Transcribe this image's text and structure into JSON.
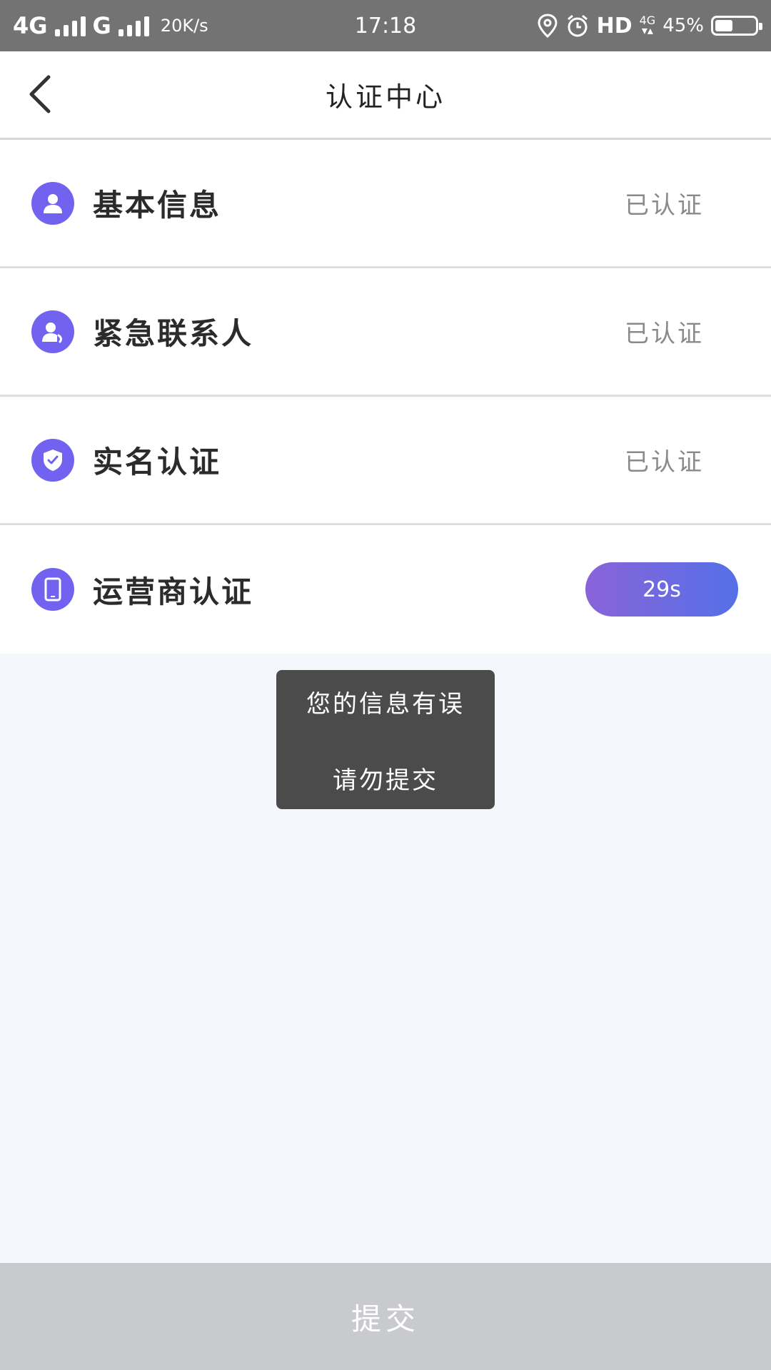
{
  "status_bar": {
    "network1": "4G",
    "network2": "G",
    "speed": "20K/s",
    "time": "17:18",
    "hd": "HD",
    "net_small": "4G",
    "battery": "45%",
    "battery_level": 0.45
  },
  "header": {
    "title": "认证中心"
  },
  "items": [
    {
      "label": "基本信息",
      "status": "已认证",
      "icon": "person-icon"
    },
    {
      "label": "紧急联系人",
      "status": "已认证",
      "icon": "contact-phone-icon"
    },
    {
      "label": "实名认证",
      "status": "已认证",
      "icon": "shield-check-icon"
    },
    {
      "label": "运营商认证",
      "status": "29s",
      "icon": "mobile-phone-icon"
    }
  ],
  "toast": {
    "line1": "您的信息有误",
    "line2": "请勿提交"
  },
  "submit": {
    "label": "提交"
  },
  "colors": {
    "accent": "#7163f0",
    "gradient_start": "#8a63d8",
    "gradient_end": "#5470e8",
    "submit_bg": "#c8cacd"
  }
}
